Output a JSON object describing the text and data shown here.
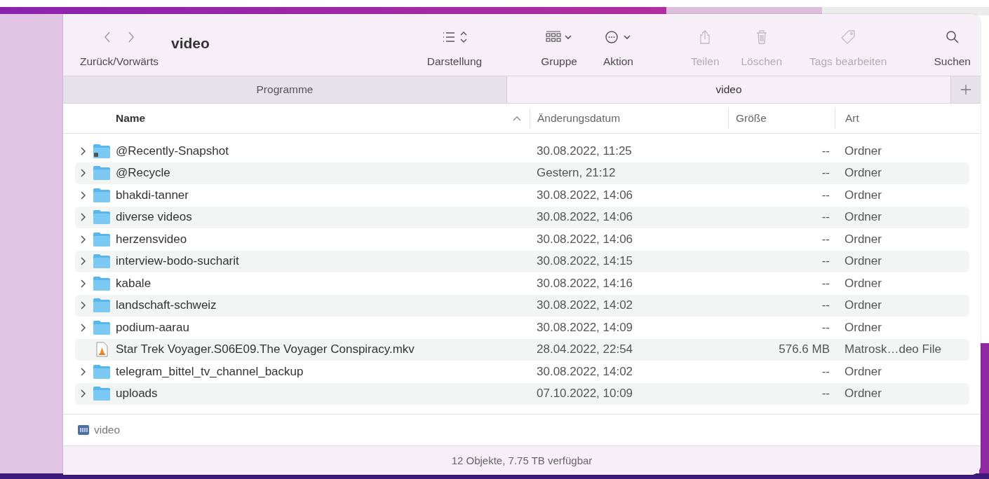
{
  "window": {
    "title": "video"
  },
  "toolbar": [
    {
      "kind": "nav",
      "label": "Zurück/Vorwärts",
      "disabled": false
    },
    {
      "kind": "view",
      "label": "Darstellung",
      "disabled": false
    },
    {
      "kind": "group",
      "label": "Gruppe",
      "disabled": false
    },
    {
      "kind": "action",
      "label": "Aktion",
      "disabled": false
    },
    {
      "kind": "share",
      "label": "Teilen",
      "disabled": true
    },
    {
      "kind": "delete",
      "label": "Löschen",
      "disabled": true
    },
    {
      "kind": "tags",
      "label": "Tags bearbeiten",
      "disabled": true
    },
    {
      "kind": "search",
      "label": "Suchen",
      "disabled": false
    }
  ],
  "tabs": [
    {
      "label": "Programme",
      "selected": false
    },
    {
      "label": "video",
      "selected": true
    }
  ],
  "columns": [
    {
      "label": "Name",
      "sorted": true
    },
    {
      "label": "Änderungsdatum",
      "sorted": false
    },
    {
      "label": "Größe",
      "sorted": false
    },
    {
      "label": "Art",
      "sorted": false
    }
  ],
  "rows": [
    {
      "kind": "locked-folder",
      "name": "@Recently-Snapshot",
      "date": "30.08.2022, 11:25",
      "size": "--",
      "type": "Ordner"
    },
    {
      "kind": "folder",
      "name": "@Recycle",
      "date": "Gestern, 21:12",
      "size": "--",
      "type": "Ordner"
    },
    {
      "kind": "folder",
      "name": "bhakdi-tanner",
      "date": "30.08.2022, 14:06",
      "size": "--",
      "type": "Ordner"
    },
    {
      "kind": "folder",
      "name": "diverse videos",
      "date": "30.08.2022, 14:06",
      "size": "--",
      "type": "Ordner"
    },
    {
      "kind": "folder",
      "name": "herzensvideo",
      "date": "30.08.2022, 14:06",
      "size": "--",
      "type": "Ordner"
    },
    {
      "kind": "folder",
      "name": "interview-bodo-sucharit",
      "date": "30.08.2022, 14:15",
      "size": "--",
      "type": "Ordner"
    },
    {
      "kind": "folder",
      "name": "kabale",
      "date": "30.08.2022, 14:16",
      "size": "--",
      "type": "Ordner"
    },
    {
      "kind": "folder",
      "name": "landschaft-schweiz",
      "date": "30.08.2022, 14:02",
      "size": "--",
      "type": "Ordner"
    },
    {
      "kind": "folder",
      "name": "podium-aarau",
      "date": "30.08.2022, 14:09",
      "size": "--",
      "type": "Ordner"
    },
    {
      "kind": "video-file",
      "name": "Star Trek Voyager.S06E09.The Voyager Conspiracy.mkv",
      "date": "28.04.2022, 22:54",
      "size": "576.6 MB",
      "type": "Matrosk…deo File"
    },
    {
      "kind": "folder",
      "name": "telegram_bittel_tv_channel_backup",
      "date": "30.08.2022, 14:02",
      "size": "--",
      "type": "Ordner"
    },
    {
      "kind": "folder",
      "name": "uploads",
      "date": "07.10.2022, 10:09",
      "size": "--",
      "type": "Ordner"
    }
  ],
  "path_bar": {
    "label": "video"
  },
  "status_bar": "12 Objekte, 7.75 TB verfügbar"
}
